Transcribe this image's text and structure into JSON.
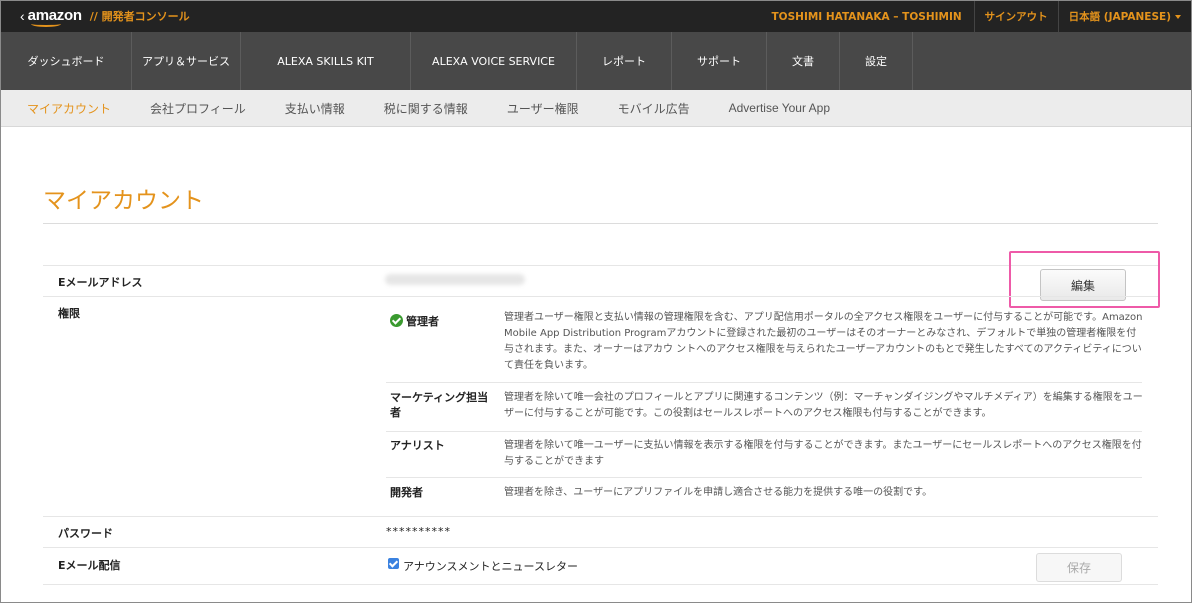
{
  "header": {
    "back_glyph": "‹",
    "brand": "amazon",
    "subtitle": "// 開発者コンソール",
    "user": "TOSHIMI HATANAKA – TOSHIMIN",
    "signout": "サインアウト",
    "language": "日本語 (JAPANESE)"
  },
  "mainnav": [
    {
      "label": "ダッシュボード"
    },
    {
      "label": "アプリ＆サービス"
    },
    {
      "label": "ALEXA SKILLS KIT"
    },
    {
      "label": "ALEXA VOICE SERVICE"
    },
    {
      "label": "レポート"
    },
    {
      "label": "サポート"
    },
    {
      "label": "文書"
    },
    {
      "label": "設定"
    }
  ],
  "subnav": [
    {
      "label": "マイアカウント"
    },
    {
      "label": "会社プロフィール"
    },
    {
      "label": "支払い情報"
    },
    {
      "label": "税に関する情報"
    },
    {
      "label": "ユーザー権限"
    },
    {
      "label": "モバイル広告"
    },
    {
      "label": "Advertise Your App"
    }
  ],
  "main": {
    "title": "マイアカウント",
    "email_label": "Eメールアドレス",
    "edit_button": "編集",
    "permissions_label": "権限",
    "roles": [
      {
        "name": "管理者",
        "desc": "管理者ユーザー権限と支払い情報の管理権限を含む、アプリ配信用ポータルの全アクセス権限をユーザーに付与することが可能です。Amazon Mobile App Distribution Programアカウントに登録された最初のユーザーはそのオーナーとみなされ、デフォルトで単独の管理者権限を付与されます。また、オーナーはアカウ ントへのアクセス権限を与えられたユーザーアカウントのもとで発生したすべてのアクティビティについて責任を負います。"
      },
      {
        "name": "マーケティング担当者",
        "desc": "管理者を除いて唯一会社のプロフィールとアプリに関連するコンテンツ（例：マーチャンダイジングやマルチメディア）を編集する権限をユーザーに付与することが可能です。この役割はセールスレポートへのアクセス権限も付与することができます。"
      },
      {
        "name": "アナリスト",
        "desc": "管理者を除いて唯一ユーザーに支払い情報を表示する権限を付与することができます。またユーザーにセールスレポートへのアクセス権限を付与することができます"
      },
      {
        "name": "開発者",
        "desc": "管理者を除き、ユーザーにアプリファイルを申請し適合させる能力を提供する唯一の役割です。"
      }
    ],
    "password_label": "パスワード",
    "password_value": "**********",
    "email_delivery_label": "Eメール配信",
    "newsletter_label": "アナウンスメントとニュースレター",
    "save_button": "保存"
  },
  "colors": {
    "accent": "#e4931c",
    "topbar": "#232323",
    "nav": "#484848",
    "highlight": "#ee5aa8",
    "check": "#3a9a2f"
  }
}
